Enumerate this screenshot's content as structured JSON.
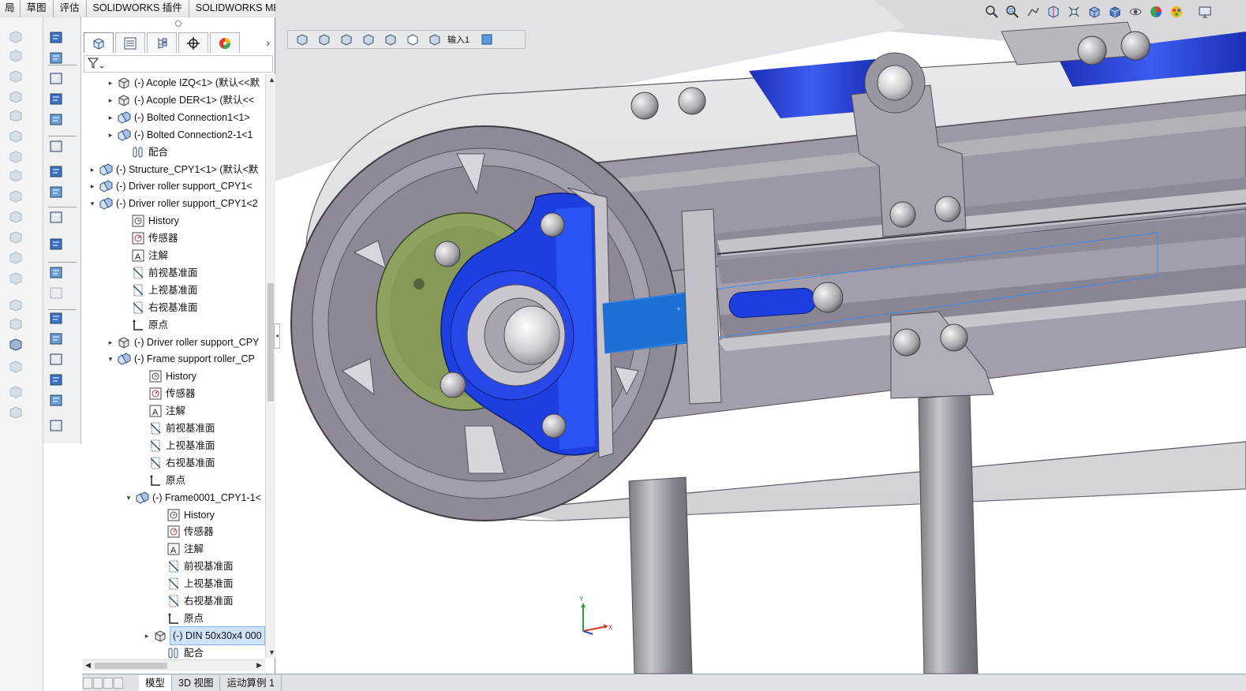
{
  "command_tabs": [
    "布局",
    "草图",
    "评估",
    "SOLIDWORKS 插件",
    "SOLIDWORKS MBD"
  ],
  "command_tabs_visible_text": [
    "局",
    "草图",
    "评估",
    "SOLIDWORKS 插件",
    "SOLIDWORKS MBD"
  ],
  "feature_manager": {
    "panel_tabs": [
      "feature-manager-tab",
      "property-manager-tab",
      "configuration-manager-tab",
      "dimxpert-manager-tab",
      "display-manager-tab"
    ],
    "tree": [
      {
        "label": "(-) Acople IZQ<1> (默认<<默",
        "expander": "▸",
        "icon": "part-icon"
      },
      {
        "label": "(-) Acople DER<1> (默认<<",
        "expander": "▸",
        "icon": "part-icon"
      },
      {
        "label": "(-) Bolted Connection1<1>",
        "expander": "▸",
        "icon": "subassembly-icon"
      },
      {
        "label": "(-) Bolted Connection2-1<1",
        "expander": "▸",
        "icon": "subassembly-icon"
      },
      {
        "label": "配合",
        "expander": "",
        "icon": "mates-icon"
      },
      {
        "label": "(-) Structure_CPY1<1> (默认<默",
        "expander": "▸",
        "icon": "subassembly-icon"
      },
      {
        "label": "(-) Driver roller support_CPY1<",
        "expander": "▸",
        "icon": "subassembly-icon"
      },
      {
        "label": "(-) Driver roller support_CPY1<2",
        "expander": "▾",
        "icon": "subassembly-icon"
      },
      {
        "label": "History",
        "expander": "",
        "icon": "history-icon"
      },
      {
        "label": "传感器",
        "expander": "",
        "icon": "sensor-icon"
      },
      {
        "label": "注解",
        "expander": "",
        "icon": "annotation-icon"
      },
      {
        "label": "前视基准面",
        "expander": "",
        "icon": "plane-icon"
      },
      {
        "label": "上视基准面",
        "expander": "",
        "icon": "plane-icon"
      },
      {
        "label": "右视基准面",
        "expander": "",
        "icon": "plane-icon"
      },
      {
        "label": "原点",
        "expander": "",
        "icon": "origin-icon"
      },
      {
        "label": "(-) Driver roller support_CPY",
        "expander": "▸",
        "icon": "part-icon"
      },
      {
        "label": "(-) Frame support roller_CP",
        "expander": "▾",
        "icon": "subassembly-icon"
      },
      {
        "label": "History",
        "expander": "",
        "icon": "history-icon"
      },
      {
        "label": "传感器",
        "expander": "",
        "icon": "sensor-icon"
      },
      {
        "label": "注解",
        "expander": "",
        "icon": "annotation-icon"
      },
      {
        "label": "前视基准面",
        "expander": "",
        "icon": "plane-icon"
      },
      {
        "label": "上视基准面",
        "expander": "",
        "icon": "plane-icon"
      },
      {
        "label": "右视基准面",
        "expander": "",
        "icon": "plane-icon"
      },
      {
        "label": "原点",
        "expander": "",
        "icon": "origin-icon"
      },
      {
        "label": "(-) Frame0001_CPY1-1<",
        "expander": "▾",
        "icon": "subassembly-icon"
      },
      {
        "label": "History",
        "expander": "",
        "icon": "history-icon"
      },
      {
        "label": "传感器",
        "expander": "",
        "icon": "sensor-icon"
      },
      {
        "label": "注解",
        "expander": "",
        "icon": "annotation-icon"
      },
      {
        "label": "前视基准面",
        "expander": "",
        "icon": "plane-icon"
      },
      {
        "label": "上视基准面",
        "expander": "",
        "icon": "plane-icon"
      },
      {
        "label": "右视基准面",
        "expander": "",
        "icon": "plane-icon"
      },
      {
        "label": "原点",
        "expander": "",
        "icon": "origin-icon"
      },
      {
        "label": "(-) DIN 50x30x4 000",
        "expander": "▸",
        "icon": "part-icon",
        "selected": true
      },
      {
        "label": "配合",
        "expander": "",
        "icon": "mates-icon"
      }
    ]
  },
  "breadcrumb": {
    "label": "输入1"
  },
  "bottom_tabs": [
    "模型",
    "3D 视图",
    "运动算例 1"
  ],
  "triad_labels": {
    "x": "X",
    "y": "Y"
  },
  "colors": {
    "highlight_blue": "#1e3fe0",
    "selection_blue": "#2a72d6",
    "plate_green": "#8ea45e",
    "frame_gray": "#9a95a0",
    "tree_selection": "#cfe4fb"
  }
}
